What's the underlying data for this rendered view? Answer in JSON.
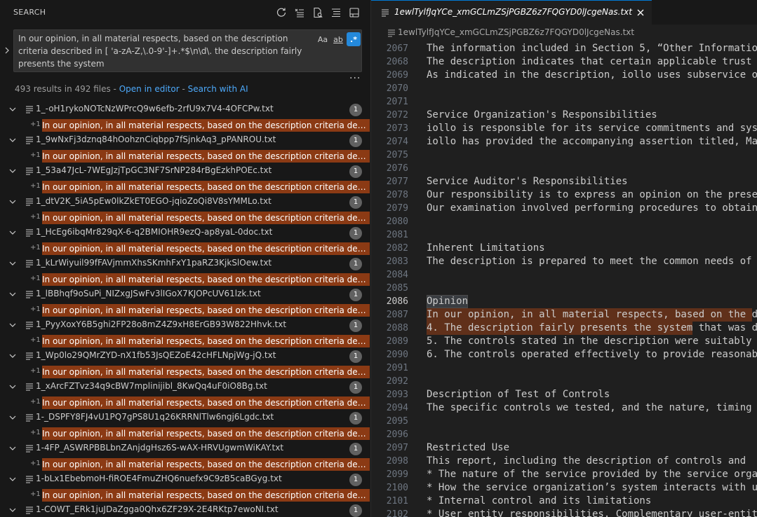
{
  "search_panel": {
    "title": "SEARCH",
    "query": "In our opinion, in all material respects, based on the description criteria described in [ 'a-zA-Z,\\.0-9'-]+.*$\\n\\d\\. the description fairly presents the system",
    "options": {
      "match_case": "Aa",
      "whole_word": "ab",
      "regex": ".*"
    },
    "more": "···",
    "summary": "493 results in 492 files - ",
    "open_in_editor": "Open in editor",
    "separator": " - ",
    "search_with_ai": "Search with AI",
    "match_prefix": "+1",
    "match_text": "In our opinion, in all material respects, based on the description criteria described in",
    "results": [
      {
        "file": "1_-oH1rykoNOTcNzWPrcQ9w6efb-2rfU9x7V4-4OFCPw.txt",
        "count": "1"
      },
      {
        "file": "1_9wNxFj3dznq84hOohznCiqbpp7fSjnkAq3_pPANROU.txt",
        "count": "1"
      },
      {
        "file": "1_53a47JcL-7WEgJzjTpGC3NF7SrNP284rBgEzkhPOEc.txt",
        "count": "1"
      },
      {
        "file": "1_dtV2K_5iA5pEw0lkZkET0EGO-jqioZoQi8V8sYMMLo.txt",
        "count": "1"
      },
      {
        "file": "1_HcEg6ibqMr829qX-6-q2BMIOHR9ezQ-ap8yaL-0doc.txt",
        "count": "1"
      },
      {
        "file": "1_kLrWiyuil99fFAVjmmXhsSKmhFxY1paRZ3KjkSlOew.txt",
        "count": "1"
      },
      {
        "file": "1_lBBhqf9oSuPi_NIZxgJSwFv3lIGoX7KJOPcUV61lzk.txt",
        "count": "1"
      },
      {
        "file": "1_PyyXoxY6B5ghi2FP28o8mZ4Z9xH8ErGB93W822Hhvk.txt",
        "count": "1"
      },
      {
        "file": "1_Wp0lo29QMrZYD-nX1fb53JsQEZoE42cHFLNpjWg-jQ.txt",
        "count": "1"
      },
      {
        "file": "1_xArcFZTvz34q9cBW7mplinijibl_8KwQq4uF0iO8Bg.txt",
        "count": "1"
      },
      {
        "file": "1-_DSPFY8FJ4vU1PQ7gPS8U1q26KRRNlTlw6ngj6Lgdc.txt",
        "count": "1"
      },
      {
        "file": "1-4FP_ASWRPBBLbnZAnjdgHsz6S-wAX-HRVUgwmWiKAY.txt",
        "count": "1"
      },
      {
        "file": "1-bLx1EbebmoH-fiROE4FmuZHQ6nuefx9C9zB5caBGyg.txt",
        "count": "1"
      },
      {
        "file": "1-COWT_ERk1juJDaZgga0Qhx6ZF29X-2E4RKtp7ewoNI.txt",
        "count": "1"
      }
    ]
  },
  "editor": {
    "tab_label": "1ewlTylfJqYCe_xmGCLmZSjPGBZ6z7FQGYD0lJcgeNas.txt",
    "breadcrumb": "1ewlTylfJqYCe_xmGCLmZSjPGBZ6z7FQGYD0lJcgeNas.txt",
    "current_line": 2086,
    "lines": [
      {
        "n": "2067",
        "t": "The information included in Section 5, “Other Informatio"
      },
      {
        "n": "2068",
        "t": "The description indicates that certain applicable trust"
      },
      {
        "n": "2069",
        "t": "As indicated in the description, iollo uses subservice o"
      },
      {
        "n": "2070",
        "t": ""
      },
      {
        "n": "2071",
        "t": ""
      },
      {
        "n": "2072",
        "t": "Service Organization's Responsibilities"
      },
      {
        "n": "2073",
        "t": "iollo is responsible for its service commitments and sys"
      },
      {
        "n": "2074",
        "t": "iollo has provided the accompanying assertion titled, Ma"
      },
      {
        "n": "2075",
        "t": ""
      },
      {
        "n": "2076",
        "t": ""
      },
      {
        "n": "2077",
        "t": "Service Auditor's Responsibilities"
      },
      {
        "n": "2078",
        "t": "Our responsibility is to express an opinion on the prese"
      },
      {
        "n": "2079",
        "t": "Our examination involved performing procedures to obtain"
      },
      {
        "n": "2080",
        "t": ""
      },
      {
        "n": "2081",
        "t": ""
      },
      {
        "n": "2082",
        "t": "Inherent Limitations"
      },
      {
        "n": "2083",
        "t": "The description is prepared to meet the common needs of"
      },
      {
        "n": "2084",
        "t": ""
      },
      {
        "n": "2085",
        "t": ""
      },
      {
        "n": "2086",
        "t": "Opinion"
      },
      {
        "n": "2087",
        "t": "In our opinion, in all material respects, based on the d"
      },
      {
        "n": "2088",
        "t": "4. The description fairly presents the system that was d"
      },
      {
        "n": "2089",
        "t": "5. The controls stated in the description were suitably"
      },
      {
        "n": "2090",
        "t": "6. The controls operated effectively to provide reasonab"
      },
      {
        "n": "2091",
        "t": ""
      },
      {
        "n": "2092",
        "t": ""
      },
      {
        "n": "2093",
        "t": "Description of Test of Controls"
      },
      {
        "n": "2094",
        "t": "The specific controls we tested, and the nature, timing"
      },
      {
        "n": "2095",
        "t": ""
      },
      {
        "n": "2096",
        "t": ""
      },
      {
        "n": "2097",
        "t": "Restricted Use"
      },
      {
        "n": "2098",
        "t": "This report, including the description of controls and"
      },
      {
        "n": "2099",
        "t": "* The nature of the service provided by the service orga"
      },
      {
        "n": "2100",
        "t": "* How the service organization’s system interacts with u"
      },
      {
        "n": "2101",
        "t": "* Internal control and its limitations"
      },
      {
        "n": "2102",
        "t": "* User entity responsibilities. Complementary user-entit"
      }
    ]
  }
}
